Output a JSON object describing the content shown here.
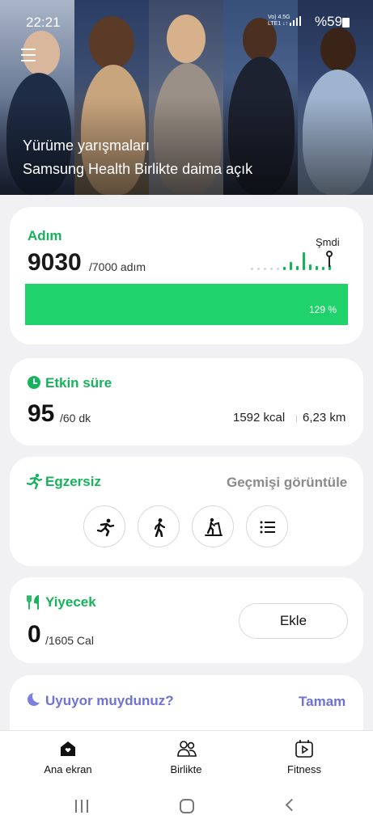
{
  "status_bar": {
    "time": "22:21",
    "network_top": "Vo) 4.5G",
    "network_bottom": "LTE1 ↓↑",
    "battery": "%59"
  },
  "hero": {
    "line1": "Yürüme yarışmaları",
    "line2": "Samsung Health Birlikte daima açık"
  },
  "steps": {
    "title": "Adım",
    "value": "9030",
    "goal": "/7000 adım",
    "now_label": "Şmdi",
    "percent_text": "129 %",
    "progress_fraction": 1.0
  },
  "active": {
    "title": "Etkin süre",
    "value": "95",
    "goal": "/60 dk",
    "kcal": "1592 kcal",
    "distance": "6,23 km"
  },
  "exercise": {
    "title": "Egzersiz",
    "history_label": "Geçmişi görüntüle",
    "buttons": [
      "running-icon",
      "walking-icon",
      "treadmill-icon",
      "list-icon"
    ]
  },
  "food": {
    "title": "Yiyecek",
    "value": "0",
    "goal": "/1605 Cal",
    "add_label": "Ekle"
  },
  "sleep": {
    "title": "Uyuyor muydunuz?",
    "ok_label": "Tamam"
  },
  "nav": {
    "home": "Ana ekran",
    "together": "Birlikte",
    "fitness": "Fitness"
  },
  "colors": {
    "accent_green": "#15b35a",
    "progress_green": "#20d26c",
    "sleep_purple": "#6c72d9"
  }
}
